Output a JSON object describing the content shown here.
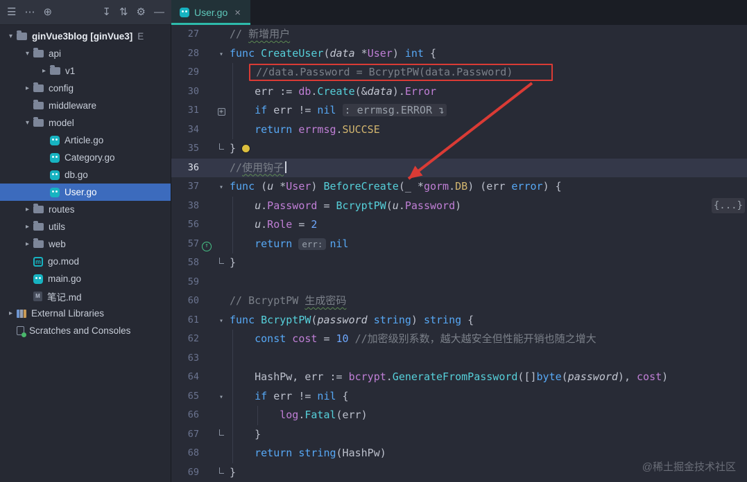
{
  "toolbar": {
    "left_icons": [
      {
        "name": "main-menu",
        "glyph": "☰"
      },
      {
        "name": "more-options",
        "glyph": "⋯"
      },
      {
        "name": "globe",
        "glyph": "⊕"
      }
    ],
    "right_icons": [
      {
        "name": "download",
        "glyph": "↧"
      },
      {
        "name": "vcs-update",
        "glyph": "⇅"
      },
      {
        "name": "settings",
        "glyph": "⚙"
      },
      {
        "name": "hide-window",
        "glyph": "—"
      }
    ]
  },
  "editor_tab": {
    "label": "User.go",
    "close": "×"
  },
  "project_tree": {
    "rows": [
      {
        "depth": 0,
        "chev": "down",
        "icon": "folder",
        "label": "ginVue3blog [ginVue3]",
        "bold": true,
        "suffix": "E"
      },
      {
        "depth": 1,
        "chev": "down",
        "icon": "folder",
        "label": "api"
      },
      {
        "depth": 2,
        "chev": "right",
        "icon": "folder",
        "label": "v1"
      },
      {
        "depth": 1,
        "chev": "right",
        "icon": "folder",
        "label": "config"
      },
      {
        "depth": 1,
        "chev": "none",
        "icon": "folder",
        "label": "middleware"
      },
      {
        "depth": 1,
        "chev": "down",
        "icon": "folder",
        "label": "model"
      },
      {
        "depth": 2,
        "chev": "none",
        "icon": "go",
        "label": "Article.go"
      },
      {
        "depth": 2,
        "chev": "none",
        "icon": "go",
        "label": "Category.go"
      },
      {
        "depth": 2,
        "chev": "none",
        "icon": "go",
        "label": "db.go"
      },
      {
        "depth": 2,
        "chev": "none",
        "icon": "go",
        "label": "User.go",
        "selected": true
      },
      {
        "depth": 1,
        "chev": "right",
        "icon": "folder",
        "label": "routes"
      },
      {
        "depth": 1,
        "chev": "right",
        "icon": "folder",
        "label": "utils"
      },
      {
        "depth": 1,
        "chev": "right",
        "icon": "folder",
        "label": "web"
      },
      {
        "depth": 1,
        "chev": "none",
        "icon": "gomod",
        "label": "go.mod"
      },
      {
        "depth": 1,
        "chev": "none",
        "icon": "go",
        "label": "main.go"
      },
      {
        "depth": 1,
        "chev": "none",
        "icon": "md",
        "label": "笔记.md"
      },
      {
        "depth": 0,
        "chev": "right",
        "icon": "lib",
        "label": "External Libraries"
      },
      {
        "depth": 0,
        "chev": "none",
        "icon": "scratch",
        "label": "Scratches and Consoles"
      }
    ]
  },
  "editor": {
    "watermark": "@稀土掘金技术社区",
    "annotation_color": "#da3b35",
    "lines": [
      {
        "num": 27,
        "indent": 0,
        "t": [
          [
            "cm",
            "// "
          ],
          [
            "cm wv",
            "新增用户"
          ]
        ]
      },
      {
        "num": 28,
        "indent": 0,
        "fold": "down",
        "t": [
          [
            "k",
            "func "
          ],
          [
            "f",
            "CreateUser"
          ],
          [
            "d",
            "("
          ],
          [
            "i",
            "data"
          ],
          [
            "d",
            " *"
          ],
          [
            "p",
            "User"
          ],
          [
            "d",
            ") "
          ],
          [
            "k",
            "int"
          ],
          [
            "d",
            " {"
          ]
        ]
      },
      {
        "num": 29,
        "indent": 1,
        "box": true,
        "guides": [
          1
        ],
        "t": [
          [
            "cm",
            "//data.Password = BcryptPW(data.Password)"
          ]
        ]
      },
      {
        "num": 30,
        "indent": 1,
        "guides": [
          1
        ],
        "t": [
          [
            "d",
            "err := "
          ],
          [
            "p",
            "db"
          ],
          [
            "d",
            "."
          ],
          [
            "f",
            "Create"
          ],
          [
            "d",
            "(&"
          ],
          [
            "i",
            "data"
          ],
          [
            "d",
            ")."
          ],
          [
            "p",
            "Error"
          ]
        ]
      },
      {
        "num": 31,
        "indent": 1,
        "fold": "plus",
        "guides": [
          1
        ],
        "t": [
          [
            "k",
            "if"
          ],
          [
            "d",
            " err != "
          ],
          [
            "k",
            "nil"
          ],
          [
            "d",
            " "
          ],
          [
            "fold",
            ": errmsg.ERROR ↴"
          ]
        ]
      },
      {
        "num": 34,
        "indent": 1,
        "guides": [
          1
        ],
        "t": [
          [
            "k",
            "return"
          ],
          [
            "d",
            " "
          ],
          [
            "p",
            "errmsg"
          ],
          [
            "d",
            "."
          ],
          [
            "c",
            "SUCCSE"
          ]
        ]
      },
      {
        "num": 35,
        "indent": 0,
        "fold": "end",
        "bulb": true,
        "t": [
          [
            "d",
            "}"
          ]
        ]
      },
      {
        "num": 36,
        "indent": 0,
        "current": true,
        "caret": true,
        "t": [
          [
            "cm",
            "//"
          ],
          [
            "cm wv",
            "使用钩子"
          ]
        ]
      },
      {
        "num": 37,
        "indent": 0,
        "fold": "down",
        "t": [
          [
            "k",
            "func"
          ],
          [
            "d",
            " ("
          ],
          [
            "i",
            "u"
          ],
          [
            "d",
            " *"
          ],
          [
            "p",
            "User"
          ],
          [
            "d",
            ") "
          ],
          [
            "f",
            "BeforeCreate"
          ],
          [
            "d",
            "(_ *"
          ],
          [
            "p",
            "gorm"
          ],
          [
            "d",
            "."
          ],
          [
            "c",
            "DB"
          ],
          [
            "d",
            ") (err "
          ],
          [
            "k",
            "error"
          ],
          [
            "d",
            ") {"
          ]
        ]
      },
      {
        "num": 38,
        "indent": 1,
        "right": "{...}",
        "guides": [
          1
        ],
        "t": [
          [
            "i",
            "u"
          ],
          [
            "d",
            "."
          ],
          [
            "p",
            "Password"
          ],
          [
            "d",
            " = "
          ],
          [
            "f",
            "BcryptPW"
          ],
          [
            "d",
            "("
          ],
          [
            "i",
            "u"
          ],
          [
            "d",
            "."
          ],
          [
            "p",
            "Password"
          ],
          [
            "d",
            ")"
          ]
        ]
      },
      {
        "num": 56,
        "indent": 1,
        "guides": [
          1
        ],
        "t": [
          [
            "i",
            "u"
          ],
          [
            "d",
            "."
          ],
          [
            "p",
            "Role"
          ],
          [
            "d",
            " = "
          ],
          [
            "n",
            "2"
          ]
        ]
      },
      {
        "num": 57,
        "indent": 1,
        "marker": "override",
        "guides": [
          1
        ],
        "t": [
          [
            "k",
            "return"
          ],
          [
            "d",
            " "
          ],
          [
            "hint",
            "err:"
          ],
          [
            "k",
            "nil"
          ]
        ]
      },
      {
        "num": 58,
        "indent": 0,
        "fold": "end",
        "t": [
          [
            "d",
            "}"
          ]
        ]
      },
      {
        "num": 59,
        "indent": 0,
        "t": []
      },
      {
        "num": 60,
        "indent": 0,
        "t": [
          [
            "cm",
            "// BcryptPW "
          ],
          [
            "cm wv",
            "生成密码"
          ]
        ]
      },
      {
        "num": 61,
        "indent": 0,
        "fold": "down",
        "t": [
          [
            "k",
            "func "
          ],
          [
            "f",
            "BcryptPW"
          ],
          [
            "d",
            "("
          ],
          [
            "i",
            "password"
          ],
          [
            "d",
            " "
          ],
          [
            "k",
            "string"
          ],
          [
            "d",
            ") "
          ],
          [
            "k",
            "string"
          ],
          [
            "d",
            " {"
          ]
        ]
      },
      {
        "num": 62,
        "indent": 1,
        "guides": [
          1
        ],
        "t": [
          [
            "k",
            "const"
          ],
          [
            "d",
            " "
          ],
          [
            "p",
            "cost"
          ],
          [
            "d",
            " = "
          ],
          [
            "n",
            "10"
          ],
          [
            "d",
            " "
          ],
          [
            "cm",
            "//加密级别系数，越大越安全但性能开销也随之增大"
          ]
        ]
      },
      {
        "num": 63,
        "indent": 0,
        "guides": [
          1
        ],
        "t": []
      },
      {
        "num": 64,
        "indent": 1,
        "guides": [
          1
        ],
        "t": [
          [
            "d",
            "HashPw, err := "
          ],
          [
            "p",
            "bcrypt"
          ],
          [
            "d",
            "."
          ],
          [
            "f",
            "GenerateFromPassword"
          ],
          [
            "d",
            "([]"
          ],
          [
            "k",
            "byte"
          ],
          [
            "d",
            "("
          ],
          [
            "i",
            "password"
          ],
          [
            "d",
            "), "
          ],
          [
            "p",
            "cost"
          ],
          [
            "d",
            ")"
          ]
        ]
      },
      {
        "num": 65,
        "indent": 1,
        "fold": "down",
        "guides": [
          1
        ],
        "t": [
          [
            "k",
            "if"
          ],
          [
            "d",
            " err != "
          ],
          [
            "k",
            "nil"
          ],
          [
            "d",
            " {"
          ]
        ]
      },
      {
        "num": 66,
        "indent": 2,
        "guides": [
          1,
          2
        ],
        "t": [
          [
            "p",
            "log"
          ],
          [
            "d",
            "."
          ],
          [
            "f",
            "Fatal"
          ],
          [
            "d",
            "("
          ],
          [
            "d",
            "err"
          ],
          [
            "d",
            ")"
          ]
        ]
      },
      {
        "num": 67,
        "indent": 1,
        "fold": "end",
        "guides": [
          1
        ],
        "t": [
          [
            "d",
            "}"
          ]
        ]
      },
      {
        "num": 68,
        "indent": 1,
        "guides": [
          1
        ],
        "t": [
          [
            "k",
            "return"
          ],
          [
            "d",
            " "
          ],
          [
            "k",
            "string"
          ],
          [
            "d",
            "("
          ],
          [
            "d",
            "HashPw"
          ],
          [
            "d",
            ")"
          ]
        ]
      },
      {
        "num": 69,
        "indent": 0,
        "fold": "end",
        "t": [
          [
            "d",
            "}"
          ]
        ]
      }
    ]
  }
}
